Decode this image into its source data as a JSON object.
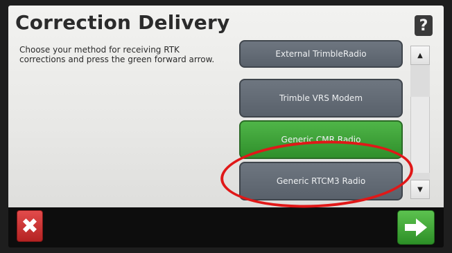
{
  "header": {
    "title": "Correction Delivery",
    "help_label": "?"
  },
  "instructions": "Choose your method for receiving RTK corrections and press the green forward arrow.",
  "options": [
    {
      "label": "External TrimbleRadio",
      "state": "normal"
    },
    {
      "label": "Trimble VRS Modem",
      "state": "normal"
    },
    {
      "label": "Generic CMR Radio",
      "state": "selected"
    },
    {
      "label": "Generic RTCM3 Radio",
      "state": "normal"
    }
  ],
  "scrollbar": {
    "up_icon": "triangle-up",
    "down_icon": "triangle-down"
  },
  "footer": {
    "cancel_icon": "x-icon",
    "next_icon": "right-arrow-icon"
  },
  "colors": {
    "option_normal": "#5f6770",
    "option_selected": "#3aa136",
    "cancel": "#c83030",
    "next": "#3fa937",
    "annotation": "#e01818"
  }
}
